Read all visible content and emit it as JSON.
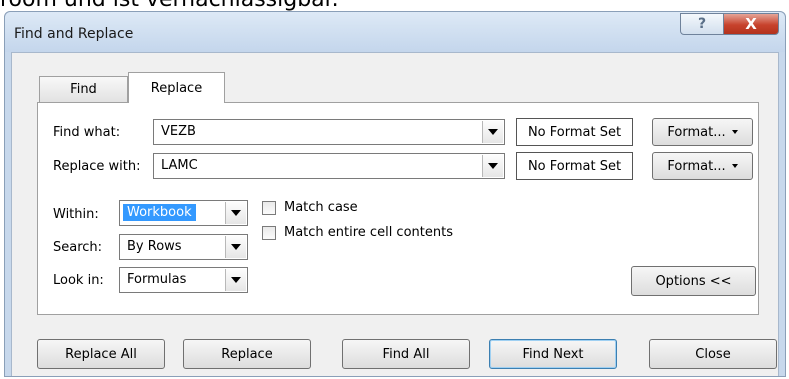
{
  "background": {
    "cutoff_text": "room und ist vernachlässigbar."
  },
  "dialog": {
    "title": "Find and Replace",
    "help_glyph": "?",
    "close_glyph": "X",
    "tabs": [
      {
        "label": "Find",
        "active": false
      },
      {
        "label": "Replace",
        "active": true
      }
    ],
    "find_what": {
      "label": "Find what:",
      "value": "VEZB",
      "format_status": "No Format Set",
      "format_button": "Format..."
    },
    "replace_with": {
      "label": "Replace with:",
      "value": "LAMC",
      "format_status": "No Format Set",
      "format_button": "Format..."
    },
    "within": {
      "label": "Within:",
      "value": "Workbook"
    },
    "search": {
      "label": "Search:",
      "value": "By Rows"
    },
    "look_in": {
      "label": "Look in:",
      "value": "Formulas"
    },
    "match_case": {
      "label": "Match case",
      "checked": false
    },
    "match_entire": {
      "label": "Match entire cell contents",
      "checked": false
    },
    "options_button": "Options <<",
    "buttons": {
      "replace_all": "Replace All",
      "replace": "Replace",
      "find_all": "Find All",
      "find_next": "Find Next",
      "close": "Close"
    }
  },
  "icons": {
    "help": "help-icon",
    "close": "close-icon",
    "dropdown": "chevron-down-icon"
  },
  "colors": {
    "title_bar": "#c4d6ec",
    "close_button": "#c7422c",
    "selection": "#3399ff",
    "default_button_border": "#3c7fb1"
  }
}
